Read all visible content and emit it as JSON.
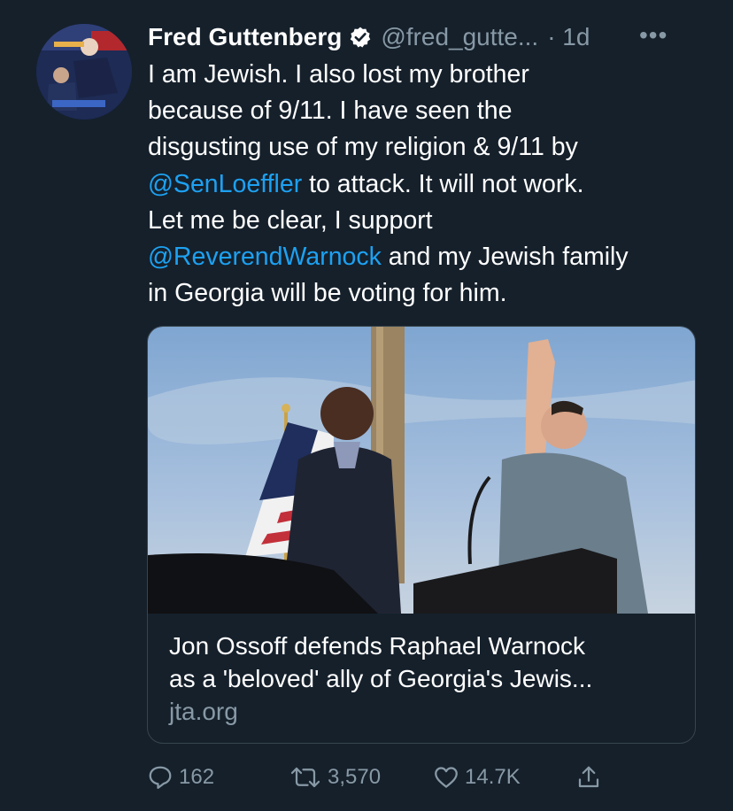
{
  "user": {
    "display_name": "Fred Guttenberg",
    "handle": "@fred_gutte...",
    "time": "· 1d",
    "verified_icon": "verified-badge-icon",
    "avatar_icon": "profile-photo"
  },
  "more_label": "•••",
  "tweet": {
    "line1": "I am Jewish.  I also lost my brother",
    "line2": "because of 9/11.  I have seen the",
    "line3": "disgusting use of my religion & 9/11 by",
    "mention1": "@SenLoeffler",
    "line4_rest": " to attack.  It will not work.",
    "line5": "Let me be clear, I support",
    "mention2": "@ReverendWarnock",
    "line6_rest": " and my Jewish family",
    "line7": "in Georgia will be voting for him."
  },
  "card": {
    "title_line1": "Jon Ossoff defends Raphael Warnock",
    "title_line2": "as a 'beloved' ally of Georgia's Jewis...",
    "domain": "jta.org"
  },
  "actions": {
    "reply_count": "162",
    "retweet_count": "3,570",
    "like_count": "14.7K"
  },
  "colors": {
    "background": "#15202b",
    "link": "#1da1f2",
    "secondary_text": "#8899a6",
    "border": "#38444d"
  }
}
